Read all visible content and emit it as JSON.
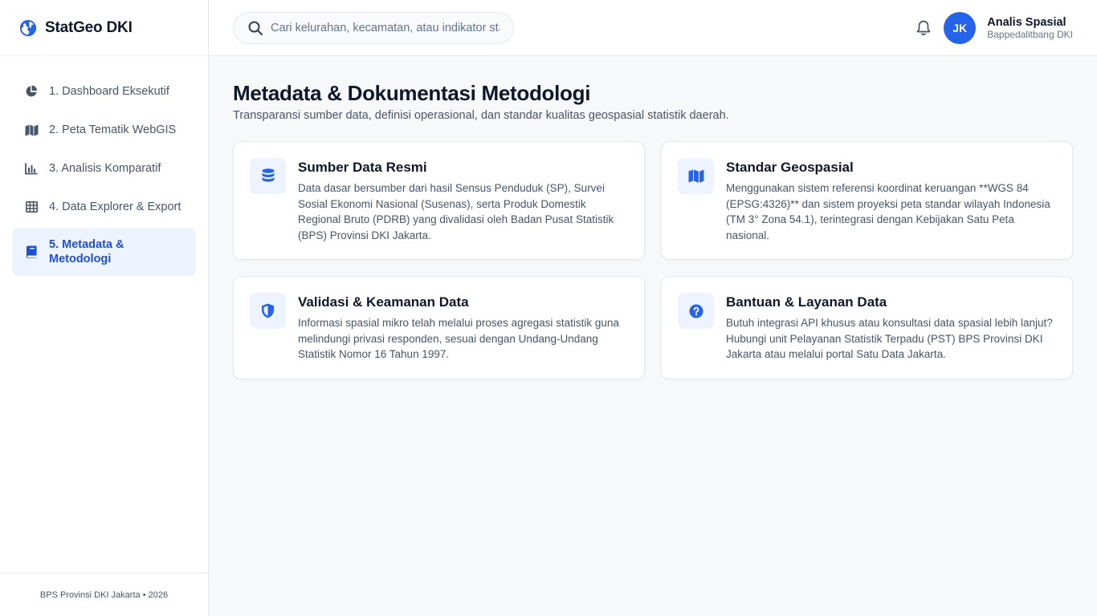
{
  "brand": {
    "name": "StatGeo DKI"
  },
  "sidebar": {
    "items": [
      {
        "label": "1. Dashboard Eksekutif",
        "icon": "pie-chart-icon"
      },
      {
        "label": "2. Peta Tematik WebGIS",
        "icon": "map-icon"
      },
      {
        "label": "3. Analisis Komparatif",
        "icon": "bar-chart-icon"
      },
      {
        "label": "4. Data Explorer & Export",
        "icon": "table-icon"
      },
      {
        "label": "5. Metadata & Metodologi",
        "icon": "book-icon",
        "active": true
      }
    ],
    "footer": "BPS Provinsi DKI Jakarta • 2026"
  },
  "search": {
    "placeholder": "Cari kelurahan, kecamatan, atau indikator statistik..."
  },
  "user": {
    "initials": "JK",
    "name": "Analis Spasial",
    "org": "Bappedalitbang DKI"
  },
  "page": {
    "title": "Metadata & Dokumentasi Metodologi",
    "subtitle": "Transparansi sumber data, definisi operasional, dan standar kualitas geospasial statistik daerah."
  },
  "cards": [
    {
      "icon": "database-icon",
      "title": "Sumber Data Resmi",
      "text": "Data dasar bersumber dari hasil Sensus Penduduk (SP), Survei Sosial Ekonomi Nasional (Susenas), serta Produk Domestik Regional Bruto (PDRB) yang divalidasi oleh Badan Pusat Statistik (BPS) Provinsi DKI Jakarta."
    },
    {
      "icon": "map-icon",
      "title": "Standar Geospasial",
      "text": "Menggunakan sistem referensi koordinat keruangan **WGS 84 (EPSG:4326)** dan sistem proyeksi peta standar wilayah Indonesia (TM 3° Zona 54.1), terintegrasi dengan Kebijakan Satu Peta nasional."
    },
    {
      "icon": "shield-icon",
      "title": "Validasi & Keamanan Data",
      "text": "Informasi spasial mikro telah melalui proses agregasi statistik guna melindungi privasi responden, sesuai dengan Undang-Undang Statistik Nomor 16 Tahun 1997."
    },
    {
      "icon": "help-circle-icon",
      "title": "Bantuan & Layanan Data",
      "text": "Butuh integrasi API khusus atau konsultasi data spasial lebih lanjut? Hubungi unit Pelayanan Statistik Terpadu (PST) BPS Provinsi DKI Jakarta atau melalui portal Satu Data Jakarta."
    }
  ],
  "colors": {
    "accent": "#2563eb",
    "active_bg": "#eef4ff",
    "icon_gray": "#475569"
  }
}
